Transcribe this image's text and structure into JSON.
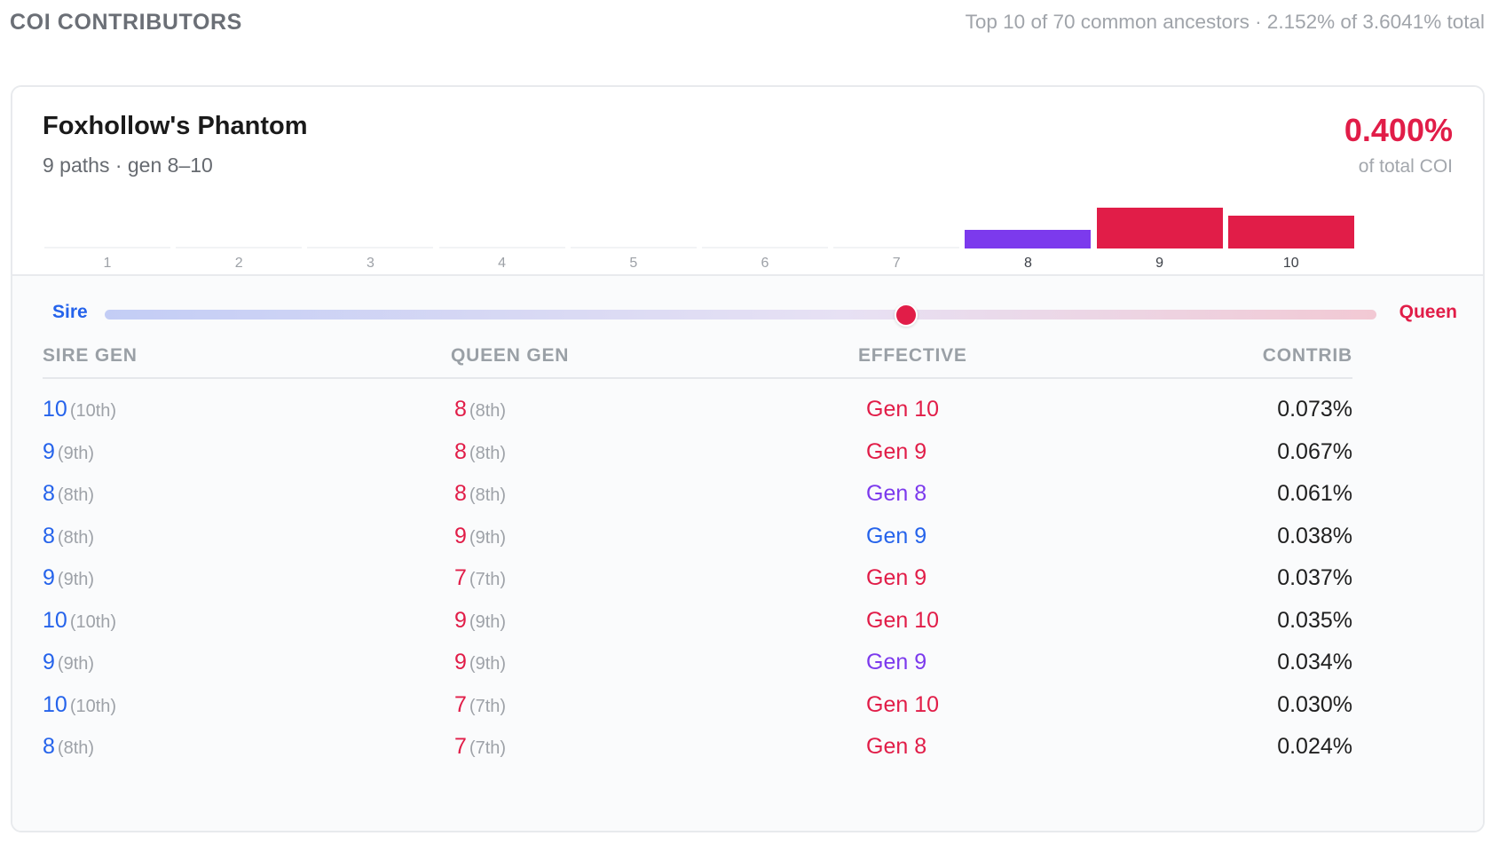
{
  "header": {
    "title": "COI CONTRIBUTORS",
    "summary": "Top 10 of 70 common ancestors · 2.152% of 3.6041% total"
  },
  "colors": {
    "sire": "#2563eb",
    "queen": "#e11d48",
    "both": "#7c3aed"
  },
  "card": {
    "name": "Foxhollow's Phantom",
    "meta": "9 paths · gen 8–10",
    "contribution": "0.400%",
    "contribution_label": "of total COI",
    "generations": [
      {
        "label": "1",
        "value": 0,
        "color": "#e11d48"
      },
      {
        "label": "2",
        "value": 0,
        "color": "#e11d48"
      },
      {
        "label": "3",
        "value": 0,
        "color": "#e11d48"
      },
      {
        "label": "4",
        "value": 0,
        "color": "#e11d48"
      },
      {
        "label": "5",
        "value": 0,
        "color": "#e11d48"
      },
      {
        "label": "6",
        "value": 0,
        "color": "#e11d48"
      },
      {
        "label": "7",
        "value": 0,
        "color": "#e11d48"
      },
      {
        "label": "8",
        "value": 0.45,
        "color": "#7c3aed"
      },
      {
        "label": "9",
        "value": 1.0,
        "color": "#e11d48"
      },
      {
        "label": "10",
        "value": 0.8,
        "color": "#e11d48"
      }
    ],
    "balance": {
      "sire_label": "Sire",
      "queen_label": "Queen",
      "position": 0.63
    },
    "table": {
      "headers": {
        "sire_gen": "SIRE GEN",
        "queen_gen": "QUEEN GEN",
        "effective": "EFFECTIVE",
        "contrib": "CONTRIB"
      },
      "rows": [
        {
          "sire": "10",
          "sire_ord": "(10th)",
          "queen": "8",
          "queen_ord": "(8th)",
          "effective": "Gen 10",
          "effective_side": "queen",
          "contrib": "0.073%"
        },
        {
          "sire": "9",
          "sire_ord": "(9th)",
          "queen": "8",
          "queen_ord": "(8th)",
          "effective": "Gen 9",
          "effective_side": "queen",
          "contrib": "0.067%"
        },
        {
          "sire": "8",
          "sire_ord": "(8th)",
          "queen": "8",
          "queen_ord": "(8th)",
          "effective": "Gen 8",
          "effective_side": "both",
          "contrib": "0.061%"
        },
        {
          "sire": "8",
          "sire_ord": "(8th)",
          "queen": "9",
          "queen_ord": "(9th)",
          "effective": "Gen 9",
          "effective_side": "sire",
          "contrib": "0.038%"
        },
        {
          "sire": "9",
          "sire_ord": "(9th)",
          "queen": "7",
          "queen_ord": "(7th)",
          "effective": "Gen 9",
          "effective_side": "queen",
          "contrib": "0.037%"
        },
        {
          "sire": "10",
          "sire_ord": "(10th)",
          "queen": "9",
          "queen_ord": "(9th)",
          "effective": "Gen 10",
          "effective_side": "queen",
          "contrib": "0.035%"
        },
        {
          "sire": "9",
          "sire_ord": "(9th)",
          "queen": "9",
          "queen_ord": "(9th)",
          "effective": "Gen 9",
          "effective_side": "both",
          "contrib": "0.034%"
        },
        {
          "sire": "10",
          "sire_ord": "(10th)",
          "queen": "7",
          "queen_ord": "(7th)",
          "effective": "Gen 10",
          "effective_side": "queen",
          "contrib": "0.030%"
        },
        {
          "sire": "8",
          "sire_ord": "(8th)",
          "queen": "7",
          "queen_ord": "(7th)",
          "effective": "Gen 8",
          "effective_side": "queen",
          "contrib": "0.024%"
        }
      ]
    }
  }
}
